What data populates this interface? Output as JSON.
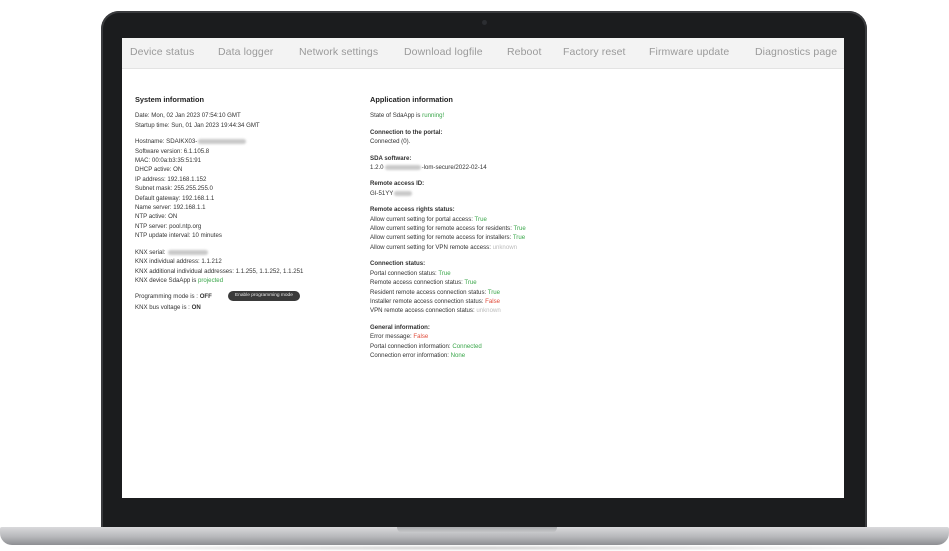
{
  "nav": {
    "items": [
      "Device status",
      "Data logger",
      "Network settings",
      "Download logfile",
      "Reboot",
      "Factory reset",
      "Firmware update",
      "Diagnostics page"
    ]
  },
  "system": {
    "heading": "System information",
    "date": "Date: Mon, 02 Jan 2023 07:54:10 GMT",
    "startup": "Startup time: Sun, 01 Jan 2023 19:44:34 GMT",
    "hostname_label": "Hostname: SDAIKX03-",
    "software": "Software version: 6.1.105.8",
    "mac": "MAC: 00:0a:b3:35:51:91",
    "dhcp": "DHCP active: ON",
    "ip": "IP address: 192.168.1.152",
    "subnet": "Subnet mask: 255.255.255.0",
    "gateway": "Default gateway: 192.168.1.1",
    "nameserver": "Name server: 192.168.1.1",
    "ntp_active": "NTP active: ON",
    "ntp_server": "NTP server: pool.ntp.org",
    "ntp_interval": "NTP update interval: 10 minutes",
    "knx_serial": "KNX serial:",
    "knx_individual": "KNX individual address: 1.1.212",
    "knx_additional": "KNX additional individual addresses: 1.1.255, 1.1.252, 1.1.251",
    "knx_device_prefix": "KNX device SdaApp is ",
    "knx_device_value": "projected",
    "prog_mode_prefix": "Programming mode is : ",
    "prog_mode_value": "OFF",
    "prog_button": "Enable programming mode",
    "bus_voltage_prefix": "KNX bus voltage is : ",
    "bus_voltage_value": "ON"
  },
  "app": {
    "heading": "Application information",
    "state_prefix": "State of SdaApp is ",
    "state_value": "running!",
    "portal_heading": "Connection to the portal:",
    "portal_value": "Connected (0).",
    "sda_heading": "SDA software:",
    "sda_prefix": "1.2.0",
    "sda_suffix": "-lom-secure/2022-02-14",
    "remote_id_heading": "Remote access ID:",
    "remote_id_prefix": "GI-51YY",
    "rights_heading": "Remote access rights status:",
    "rights": [
      {
        "label": "Allow current setting for portal access: ",
        "value": "True",
        "status": "green"
      },
      {
        "label": "Allow current setting for remote access for residents: ",
        "value": "True",
        "status": "green"
      },
      {
        "label": "Allow current setting for remote access for installers: ",
        "value": "True",
        "status": "green"
      },
      {
        "label": "Allow current setting for VPN remote access: ",
        "value": "unknown",
        "status": "grey"
      }
    ],
    "conn_heading": "Connection status:",
    "conn": [
      {
        "label": "Portal connection status: ",
        "value": "True",
        "status": "green"
      },
      {
        "label": "Remote access connection status: ",
        "value": "True",
        "status": "green"
      },
      {
        "label": "Resident remote access connection status: ",
        "value": "True",
        "status": "green"
      },
      {
        "label": "Installer remote access connection status: ",
        "value": "False",
        "status": "red"
      },
      {
        "label": "VPN remote access connection status: ",
        "value": "unknown",
        "status": "grey"
      }
    ],
    "general_heading": "General information:",
    "general": [
      {
        "label": "Error message: ",
        "value": "False",
        "status": "red"
      },
      {
        "label": "Portal connection information: ",
        "value": "Connected",
        "status": "green"
      },
      {
        "label": "Connection error information: ",
        "value": "None",
        "status": "green"
      }
    ]
  },
  "colors": {
    "ok": "#3aa64a",
    "error": "#e04b3a",
    "unknown": "#bbbbbb",
    "bezel": "#1b1c1e"
  }
}
